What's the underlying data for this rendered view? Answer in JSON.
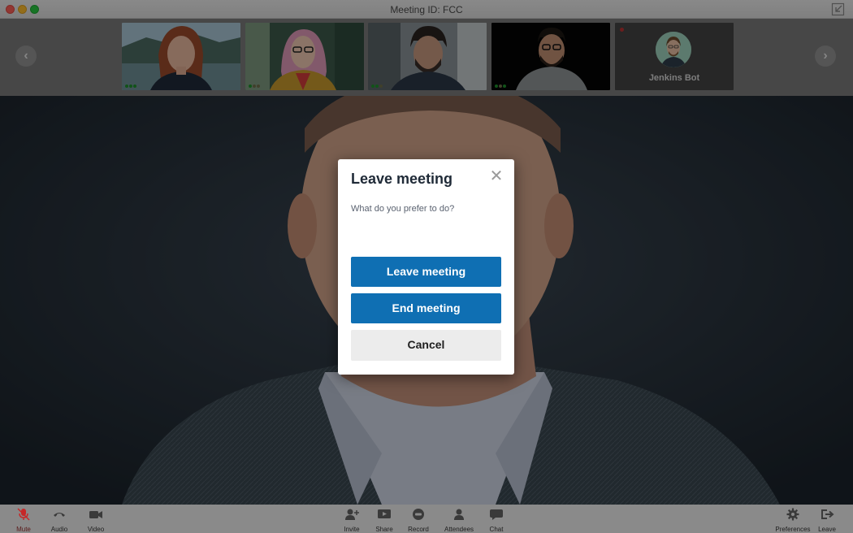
{
  "window": {
    "title": "Meeting ID: FCC"
  },
  "participants": {
    "thumbnails": [
      {
        "kind": "video",
        "signal": 3
      },
      {
        "kind": "video",
        "signal": 1
      },
      {
        "kind": "video",
        "signal": 2
      },
      {
        "kind": "video",
        "signal": 3
      },
      {
        "kind": "avatar",
        "name": "Jenkins Bot"
      }
    ],
    "prev_icon": "chevron-left-icon",
    "next_icon": "chevron-right-icon"
  },
  "dialog": {
    "title": "Leave meeting",
    "question": "What do you prefer to do?",
    "leave_label": "Leave meeting",
    "end_label": "End meeting",
    "cancel_label": "Cancel",
    "close_icon": "close-icon"
  },
  "toolbar": {
    "mute": "Mute",
    "audio": "Audio",
    "video": "Video",
    "invite": "Invite",
    "share": "Share",
    "record": "Record",
    "attendees": "Attendees",
    "chat": "Chat",
    "preferences": "Preferences",
    "leave": "Leave"
  },
  "colors": {
    "primary_button": "#0f6fb3",
    "mute_active": "#c62828",
    "signal_good": "#1e8f2b"
  }
}
